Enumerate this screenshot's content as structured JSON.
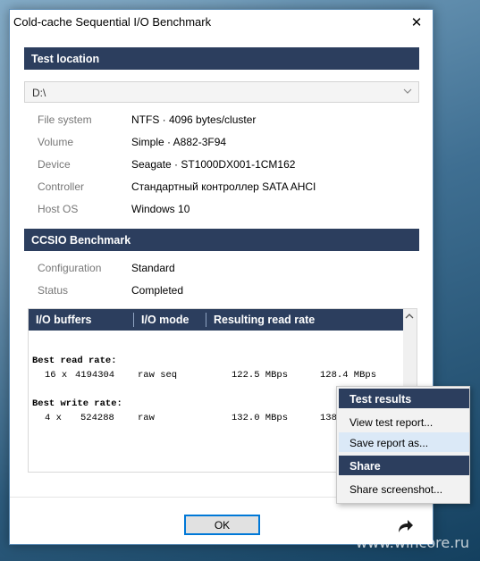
{
  "window": {
    "title": "Cold-cache Sequential I/O Benchmark",
    "close_glyph": "✕"
  },
  "test_location": {
    "header": "Test location",
    "drive_value": "D:\\",
    "dropdown_icon": "chevron-down-icon",
    "properties": [
      {
        "label": "File system",
        "value": "NTFS  ·  4096 bytes/cluster"
      },
      {
        "label": "Volume",
        "value": "Simple  ·  A882-3F94"
      },
      {
        "label": "Device",
        "value": "Seagate  ·  ST1000DX001-1CM162"
      },
      {
        "label": "Controller",
        "value": "Стандартный контроллер SATA AHCI"
      },
      {
        "label": "Host OS",
        "value": "Windows 10"
      }
    ]
  },
  "benchmark": {
    "header": "CCSIO Benchmark",
    "properties": [
      {
        "label": "Configuration",
        "value": "Standard"
      },
      {
        "label": "Status",
        "value": "Completed"
      }
    ]
  },
  "results": {
    "columns": [
      "I/O buffers",
      "I/O mode",
      "Resulting read rate"
    ],
    "best_read_title": "Best read rate:",
    "best_read_row": {
      "count": "16 x",
      "size": "4194304",
      "mode": "raw seq",
      "rate1": "122.5 MBps",
      "rate2": "128.4 MBps"
    },
    "best_write_title": "Best write rate:",
    "best_write_row": {
      "count": "4 x",
      "size": "524288",
      "mode": "raw",
      "rate1": "132.0 MBps",
      "rate2": "138"
    }
  },
  "footer": {
    "ok_label": "OK",
    "share_icon": "share-arrow-icon"
  },
  "context_menu": {
    "section1": "Test results",
    "view_report": "View test report...",
    "save_report": "Save report as...",
    "section2": "Share",
    "share_screenshot": "Share screenshot..."
  },
  "watermark": "www.wincore.ru",
  "colors": {
    "header_bg": "#2c3e5e",
    "accent": "#0078d7",
    "menu_hover": "#dbe9f7"
  }
}
